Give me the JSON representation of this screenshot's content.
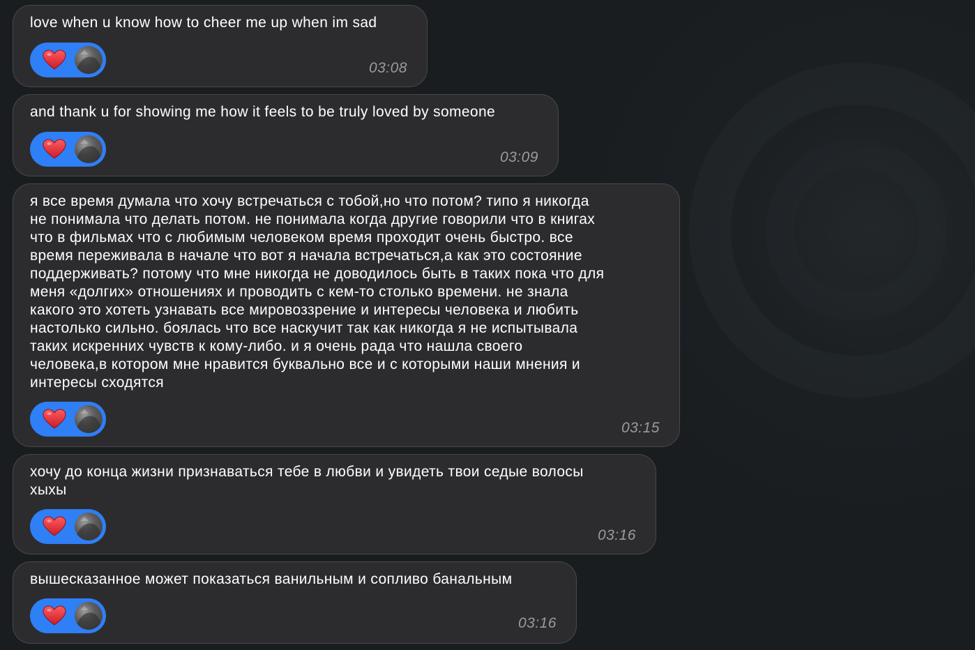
{
  "messages": [
    {
      "text": "love when u know how to cheer me up when im sad",
      "time": "03:08",
      "reaction": "heart"
    },
    {
      "text": "and thank u for showing me how it feels to be truly loved by someone",
      "time": "03:09",
      "reaction": "heart"
    },
    {
      "text": "я все время думала что хочу встречаться с тобой,но что потом? типо я никогда\nне понимала что делать потом. не понимала когда другие говорили что в книгах\nчто в фильмах что с любимым человеком время проходит очень быстро. все\nвремя переживала в начале что вот я начала встречаться,а как это состояние\nподдерживать? потому что мне никогда не доводилось быть в таких пока что для\nменя «долгих» отношениях и проводить с кем-то столько времени. не знала\nкакого это хотеть узнавать все мировоззрение и интересы человека и любить\nнастолько сильно. боялась что все наскучит так как никогда я не испытывала\nтаких искренних чувств к кому-либо. и я очень рада что нашла своего\nчеловека,в котором мне нравится буквально все и с которыми наши мнения и\nинтересы сходятся",
      "time": "03:15",
      "reaction": "heart"
    },
    {
      "text": "хочу до конца жизни признаваться тебе в любви и увидеть твои седые волосы\nхыхы",
      "time": "03:16",
      "reaction": "heart"
    },
    {
      "text": "вышесказанное может показаться ванильным и сопливо банальным",
      "time": "03:16",
      "reaction": "heart"
    }
  ],
  "colors": {
    "background": "#1c2023",
    "bubble": "#2c2c2e",
    "bubble_border": "#48484c",
    "text": "#ffffff",
    "timestamp": "#9a9aa0",
    "reaction_pill": "#2f7ff6",
    "heart": "#e0282e"
  },
  "icons": {
    "reaction": "heart-icon",
    "reactor": "avatar"
  }
}
